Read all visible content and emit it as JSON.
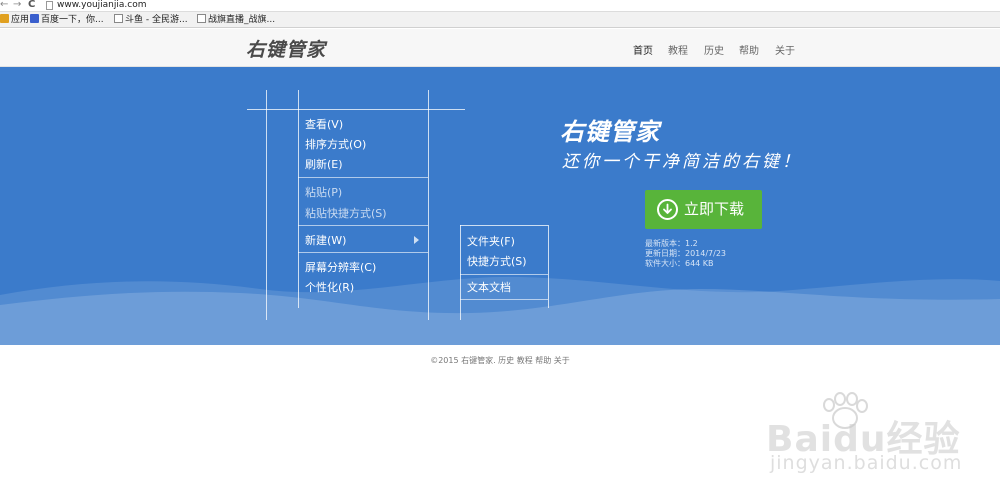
{
  "browser": {
    "back": "←",
    "forward": "→",
    "reload": "C",
    "url": "www.youjianjia.com",
    "bookmarks": [
      "应用",
      "百度一下，你...",
      "斗鱼 - 全民游...",
      "战旗直播_战旗..."
    ]
  },
  "site": {
    "logo": "右键管家",
    "nav": [
      "首页",
      "教程",
      "历史",
      "帮助",
      "关于"
    ]
  },
  "hero": {
    "title": "右键管家",
    "slogan": "还你一个干净简洁的右键！",
    "download_label": "立即下载",
    "version": "最新版本：1.2",
    "update_date": "更新日期：2014/7/23",
    "size": "软件大小：644 KB",
    "menu": {
      "view": "查看(V)",
      "sort": "排序方式(O)",
      "refresh": "刷新(E)",
      "paste": "粘贴(P)",
      "paste_shortcut": "粘贴快捷方式(S)",
      "new": "新建(W)",
      "resolution": "屏幕分辨率(C)",
      "personalize": "个性化(R)"
    },
    "submenu": {
      "folder": "文件夹(F)",
      "shortcut": "快捷方式(S)",
      "textdoc": "文本文档"
    }
  },
  "footer": {
    "text": "©2015 右键管家. 历史 教程 帮助 关于"
  },
  "watermark": {
    "main": "Baidu经验",
    "sub": "jingyan.baidu.com"
  },
  "colors": {
    "hero_bg": "#3b7bcb",
    "download_green": "#58b43a"
  }
}
